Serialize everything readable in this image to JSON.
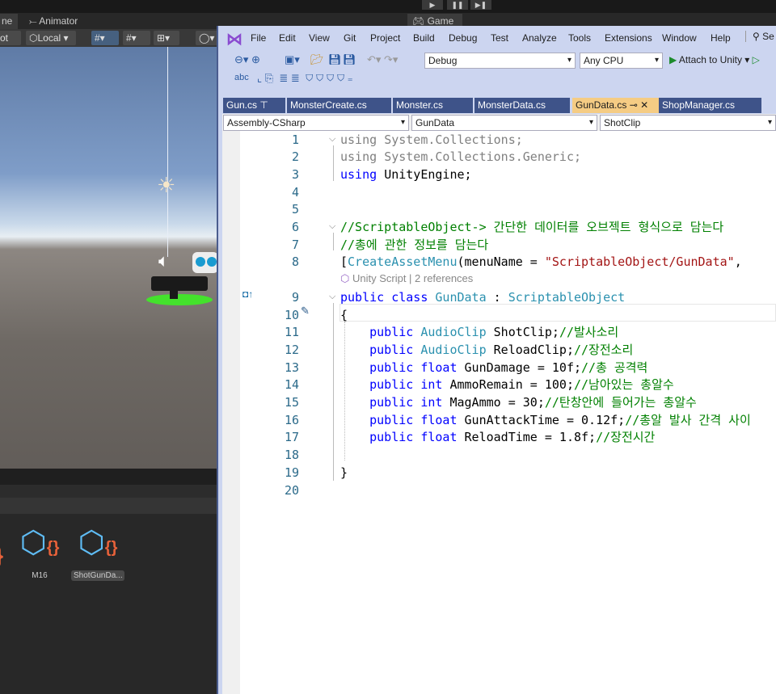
{
  "unity": {
    "play_controls": [
      "▶",
      "❚❚",
      "▶❚"
    ],
    "tabs": [
      "ne",
      "Animator",
      "Game"
    ],
    "toolbar": {
      "pivot": "ot",
      "space": "Local"
    },
    "assets": [
      {
        "name": "M16"
      },
      {
        "name": "ShotGunDa..."
      }
    ]
  },
  "vs": {
    "menu": [
      "File",
      "Edit",
      "View",
      "Git",
      "Project",
      "Build",
      "Debug",
      "Test",
      "Analyze",
      "Tools",
      "Extensions",
      "Window",
      "Help"
    ],
    "search": "Se",
    "config": "Debug",
    "platform": "Any CPU",
    "attach": "Attach to Unity",
    "tabs": [
      {
        "label": "Gun.cs",
        "pinned": true
      },
      {
        "label": "MonsterCreate.cs"
      },
      {
        "label": "Monster.cs"
      },
      {
        "label": "MonsterData.cs"
      },
      {
        "label": "GunData.cs",
        "active": true
      },
      {
        "label": "ShopManager.cs"
      }
    ],
    "nav": {
      "project": "Assembly-CSharp",
      "type": "GunData",
      "member": "ShotClip"
    },
    "codelens": "Unity Script | 2 references",
    "lines": [
      [
        [
          "using ",
          "kw gr"
        ],
        [
          "System.Collections;",
          "gr"
        ]
      ],
      [
        [
          "using ",
          "kw gr"
        ],
        [
          "System.Collections.Generic;",
          "gr"
        ]
      ],
      [
        [
          "using ",
          "kw"
        ],
        [
          "UnityEngine;",
          ""
        ]
      ],
      [],
      [],
      [
        [
          "//ScriptableObject-> 간단한 데이터를 오브젝트 형식으로 담는다",
          "cm"
        ]
      ],
      [
        [
          "//총에 관한 정보를 담는다",
          "cm"
        ]
      ],
      [
        [
          "[",
          ""
        ],
        [
          "CreateAssetMenu",
          "ty"
        ],
        [
          "(menuName = ",
          ""
        ],
        [
          "\"ScriptableObject/GunData\"",
          "st"
        ],
        [
          ",",
          ""
        ]
      ],
      [
        [
          "public ",
          "kw"
        ],
        [
          "class ",
          "kw"
        ],
        [
          "GunData",
          "ty"
        ],
        [
          " : ",
          ""
        ],
        [
          "ScriptableObject",
          "ty"
        ]
      ],
      [
        [
          "{",
          ""
        ]
      ],
      [
        [
          "    public ",
          "kw"
        ],
        [
          "AudioClip",
          "ty"
        ],
        [
          " ShotClip;",
          ""
        ],
        [
          "//발사소리",
          "cm"
        ]
      ],
      [
        [
          "    public ",
          "kw"
        ],
        [
          "AudioClip",
          "ty"
        ],
        [
          " ReloadClip;",
          ""
        ],
        [
          "//장전소리",
          "cm"
        ]
      ],
      [
        [
          "    public ",
          "kw"
        ],
        [
          "float",
          "kw"
        ],
        [
          " GunDamage = 10f;",
          ""
        ],
        [
          "//총 공격력",
          "cm"
        ]
      ],
      [
        [
          "    public ",
          "kw"
        ],
        [
          "int",
          "kw"
        ],
        [
          " AmmoRemain = 100;",
          ""
        ],
        [
          "//남아있는 총알수",
          "cm"
        ]
      ],
      [
        [
          "    public ",
          "kw"
        ],
        [
          "int",
          "kw"
        ],
        [
          " MagAmmo = 30;",
          ""
        ],
        [
          "//탄창안에 들어가는 총알수",
          "cm"
        ]
      ],
      [
        [
          "    public ",
          "kw"
        ],
        [
          "float",
          "kw"
        ],
        [
          " GunAttackTime = 0.12f;",
          ""
        ],
        [
          "//총알 발사 간격 사이",
          "cm"
        ]
      ],
      [
        [
          "    public ",
          "kw"
        ],
        [
          "float",
          "kw"
        ],
        [
          " ReloadTime = 1.8f;",
          ""
        ],
        [
          "//장전시간",
          "cm"
        ]
      ],
      [],
      [
        [
          "}",
          ""
        ]
      ],
      []
    ]
  }
}
